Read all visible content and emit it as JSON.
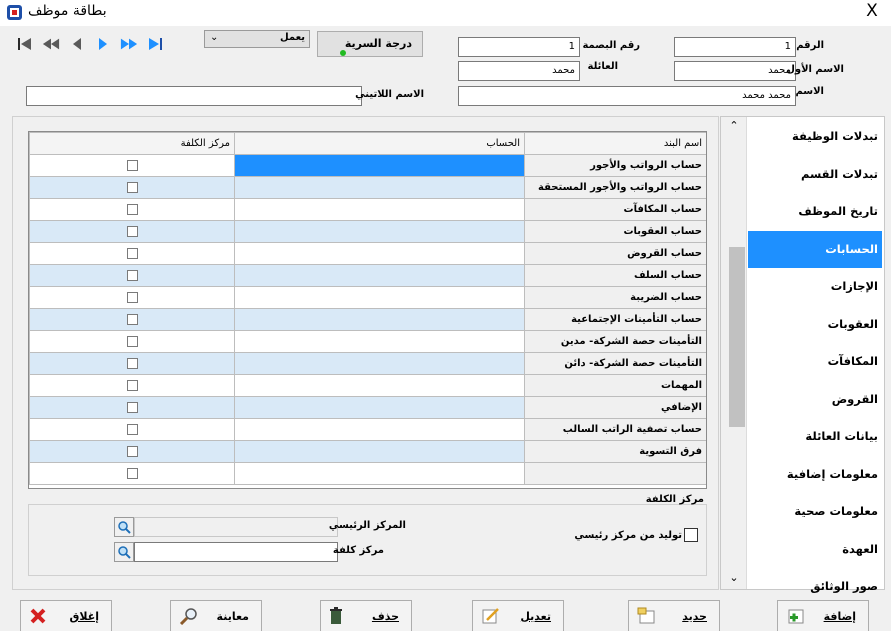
{
  "window": {
    "title": "بطاقة موظف",
    "close_symbol": "X"
  },
  "header": {
    "confidentiality_button": "درجة السرية",
    "status_select": "يعمل",
    "fields": {
      "number_label": "الرقم",
      "number_value": "1",
      "fingerprint_label": "رقم البصمة",
      "fingerprint_value": "1",
      "first_name_label": "الاسم الأول",
      "first_name_value": "محمد",
      "family_label": "العائلة",
      "family_value": "محمد",
      "name_label": "الاسم",
      "name_value": "محمد محمد",
      "latin_name_label": "الاسم اللاتيني",
      "latin_name_value": ""
    }
  },
  "grid": {
    "columns": [
      "اسم البند",
      "الحساب",
      "مركز الكلفة"
    ],
    "rows": [
      {
        "name": "حساب الرواتب والأجور",
        "account": "",
        "selected": true
      },
      {
        "name": "حساب الرواتب والأجور المستحقة",
        "account": ""
      },
      {
        "name": "حساب المكافآت",
        "account": ""
      },
      {
        "name": "حساب العقوبات",
        "account": ""
      },
      {
        "name": "حساب القروض",
        "account": ""
      },
      {
        "name": "حساب السلف",
        "account": ""
      },
      {
        "name": "حساب الضريبة",
        "account": ""
      },
      {
        "name": "حساب التأمينات الإجتماعية",
        "account": ""
      },
      {
        "name": "التأمينات حصة الشركة- مدين",
        "account": ""
      },
      {
        "name": "التأمينات حصة الشركة- دائن",
        "account": ""
      },
      {
        "name": "المهمات",
        "account": ""
      },
      {
        "name": "الإضافي",
        "account": ""
      },
      {
        "name": "حساب تصفية الراتب السالب",
        "account": ""
      },
      {
        "name": "فرق التسوية",
        "account": ""
      },
      {
        "name": "",
        "account": ""
      }
    ]
  },
  "cost_center": {
    "section_label": "مركز الكلفة",
    "main_label": "المركز الرئيسي",
    "center_label": "مركز كلفة",
    "generate_label": "توليد من مركز رئيسي"
  },
  "sidebar": {
    "items": [
      {
        "label": "تبدلات الوظيفة"
      },
      {
        "label": "تبدلات القسم"
      },
      {
        "label": "تاريخ الموظف"
      },
      {
        "label": "الحسابات",
        "active": true
      },
      {
        "label": "الإجازات"
      },
      {
        "label": "العقوبات"
      },
      {
        "label": "المكافآت"
      },
      {
        "label": "القروض"
      },
      {
        "label": "بيانات العائلة"
      },
      {
        "label": "معلومات إضافية"
      },
      {
        "label": "معلومات صحية"
      },
      {
        "label": "العهدة"
      },
      {
        "label": "صور الوثائق"
      }
    ]
  },
  "buttons": {
    "close": "إغلاق",
    "preview": "معاينة",
    "delete": "حذف",
    "edit": "تعديل",
    "new": "جديد",
    "add": "إضافة"
  },
  "colors": {
    "accent": "#1e90ff",
    "alt_row": "#d9e9f7",
    "nav_blue": "#1e90ff",
    "status_dot": "#22bb22",
    "close_red": "#d42020"
  }
}
